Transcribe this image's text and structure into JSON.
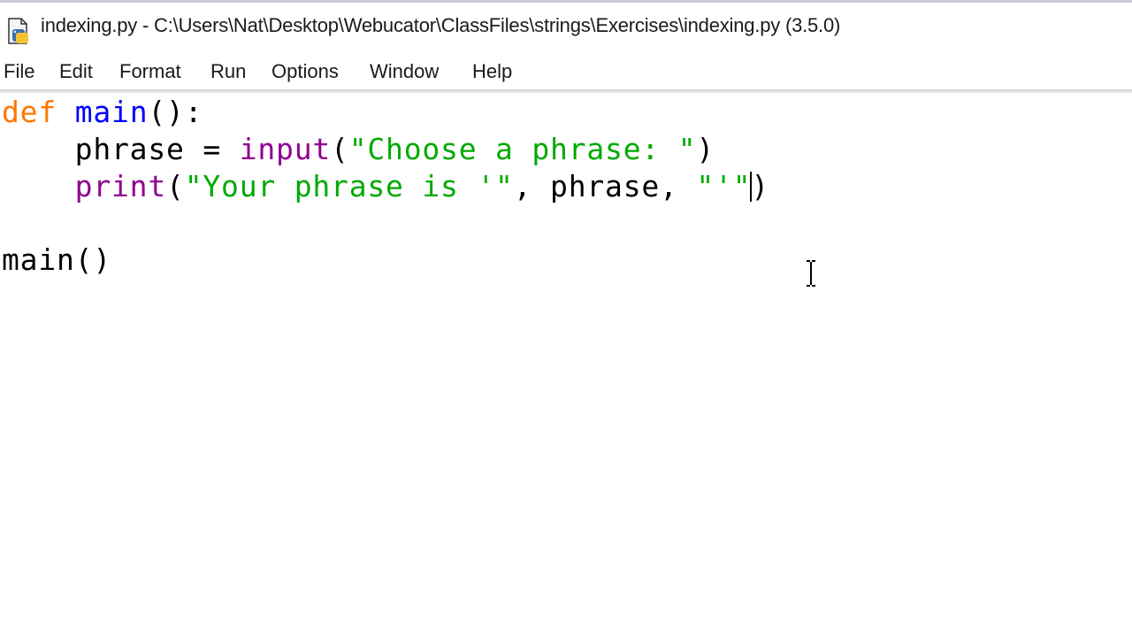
{
  "window": {
    "title": "indexing.py - C:\\Users\\Nat\\Desktop\\Webucator\\ClassFiles\\strings\\Exercises\\indexing.py (3.5.0)",
    "icon": "idle-file-icon"
  },
  "menu": {
    "items": [
      "File",
      "Edit",
      "Format",
      "Run",
      "Options",
      "Window",
      "Help"
    ]
  },
  "editor": {
    "lines": [
      {
        "kw": "def",
        "name": "main",
        "rest": "():"
      },
      {
        "indent": "    ",
        "plain1": "phrase = ",
        "builtin": "input",
        "open": "(",
        "string": "\"Choose a phrase: \"",
        "close": ")"
      },
      {
        "indent": "    ",
        "builtin": "print",
        "open": "(",
        "string1": "\"Your phrase is '\"",
        "mid": ", phrase, ",
        "string2": "\"'\"",
        "close": ")"
      },
      {
        "blank": ""
      },
      {
        "plain": "main()"
      }
    ]
  },
  "colors": {
    "keyword": "#ff7700",
    "definition": "#0000ff",
    "builtin": "#900090",
    "string": "#00aa00"
  }
}
